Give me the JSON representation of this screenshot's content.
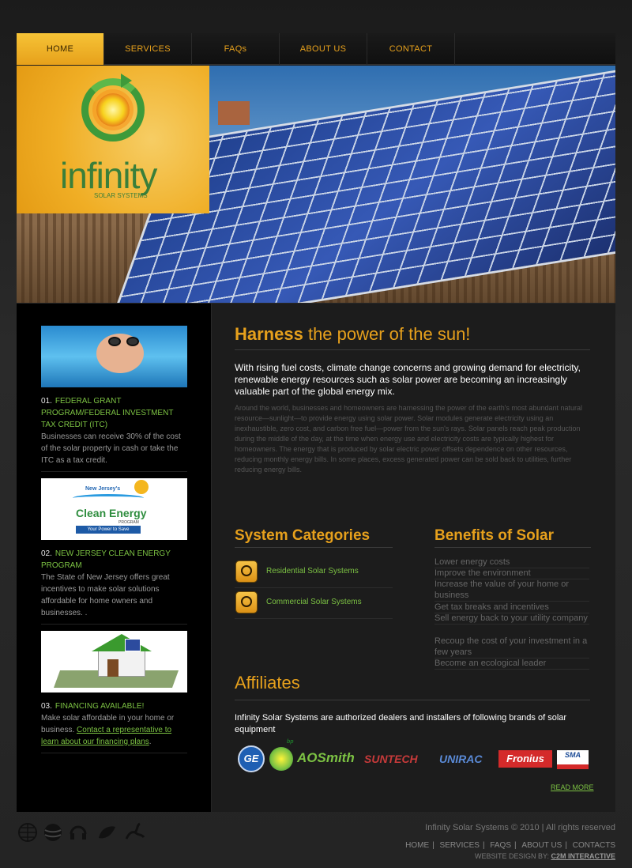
{
  "nav": {
    "items": [
      {
        "label": "HOME",
        "active": true
      },
      {
        "label": "SERVICES"
      },
      {
        "label": "FAQs"
      },
      {
        "label": "ABOUT US"
      },
      {
        "label": "CONTACT"
      }
    ]
  },
  "logo": {
    "name": "infinity",
    "sub": "SOLAR SYSTEMS"
  },
  "promos": [
    {
      "num": "01.",
      "title": "FEDERAL GRANT PROGRAM/FEDERAL INVESTMENT TAX CREDIT (ITC)",
      "body": "Businesses can receive 30% of the cost of the solar property in cash or take the ITC as a tax credit."
    },
    {
      "num": "02.",
      "title": "NEW JERSEY CLEAN ENERGY PROGRAM",
      "body": "The State of New Jersey offers great incentives to make solar solutions affordable for home owners and businesses. .",
      "img_text": {
        "line1": "New Jersey's",
        "line2": "Clean Energy",
        "line3": "PROGRAM",
        "tag": "Your Power to Save"
      }
    },
    {
      "num": "03.",
      "title": "FINANCING AVAILABLE!",
      "body": "Make solar affordable in your home or business.",
      "link": "Contact a representative to learn about our financing plans",
      "tail": "."
    }
  ],
  "main": {
    "title_bold": "Harness",
    "title_rest": " the power of the sun!",
    "intro": "With rising fuel costs, climate change concerns and growing demand for electricity, renewable energy resources such as solar power are becoming an increasingly valuable part of the global energy mix.",
    "body": "Around the world, businesses and homeowners are harnessing the power of the earth's most abundant natural resource—sunlight—to provide energy using solar power. Solar modules generate electricity using an inexhaustible, zero cost, and carbon free fuel—power from the sun's rays. Solar panels reach peak production during the middle of the day, at the time when energy use and electricity costs are typically highest for homeowners. The energy that is produced by solar electric power offsets dependence on other resources, reducing monthly energy bills. In some places, excess generated power can be sold back to utilities, further reducing energy bills.",
    "categories_title": "System Categories",
    "categories": [
      "Residential Solar Systems",
      "Commercial Solar Systems"
    ],
    "benefits_title": "Benefits of Solar",
    "benefits": [
      "Lower energy costs",
      "Improve the environment",
      "Increase the value of your home or business",
      "Get tax breaks and incentives",
      "Sell energy back to your utility company",
      "Recoup the cost of your investment in a few years",
      "Become an ecological leader"
    ],
    "affiliates_title": "Affiliates",
    "affiliates_text": "Infinity Solar Systems are authorized dealers and installers of following brands of solar equipment",
    "brands": [
      "GE",
      "bp",
      "AOSmith",
      "SUNTECH",
      "UNIRAC",
      "Fronius",
      "SMA"
    ],
    "read_more": "READ MORE"
  },
  "footer": {
    "copyright": "Infinity Solar Systems © 2010 | All rights reserved",
    "nav": [
      "HOME",
      "SERVICES",
      "FAQS",
      "ABOUT US",
      "CONTACTS"
    ],
    "credit_prefix": "WEBSITE DESIGN BY: ",
    "credit_name": "C2M INTERACTIVE"
  },
  "colors": {
    "accent": "#e6a01c",
    "green": "#7cc243"
  }
}
